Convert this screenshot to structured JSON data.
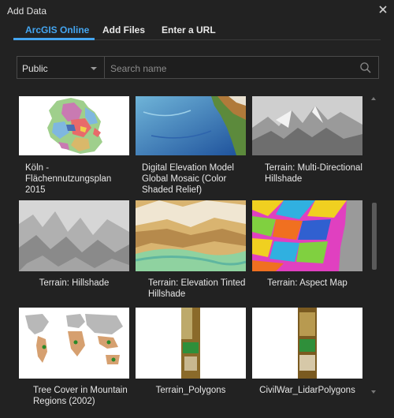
{
  "window": {
    "title": "Add Data"
  },
  "tabs": [
    {
      "label": "ArcGIS Online",
      "active": true
    },
    {
      "label": "Add Files",
      "active": false
    },
    {
      "label": "Enter a URL",
      "active": false
    }
  ],
  "filter": {
    "selected": "Public"
  },
  "search": {
    "placeholder": "Search name",
    "value": ""
  },
  "items": [
    {
      "title": "Köln - Flächennutzungsplan 2015",
      "thumbnail": "land-use-map"
    },
    {
      "title": "Digital Elevation Model Global Mosaic (Color Shaded Relief)",
      "thumbnail": "color-shaded-relief"
    },
    {
      "title": "Terrain: Multi-Directional Hillshade",
      "thumbnail": "multidirectional-hillshade"
    },
    {
      "title": "Terrain: Hillshade",
      "thumbnail": "hillshade"
    },
    {
      "title": "Terrain: Elevation Tinted Hillshade",
      "thumbnail": "elevation-tinted-hillshade"
    },
    {
      "title": "Terrain: Aspect Map",
      "thumbnail": "aspect-map"
    },
    {
      "title": "Tree Cover in Mountain Regions (2002)",
      "thumbnail": "world-tree-cover"
    },
    {
      "title": "Terrain_Polygons",
      "thumbnail": "terrain-strip"
    },
    {
      "title": "CivilWar_LidarPolygons",
      "thumbnail": "lidar-strip"
    }
  ],
  "colors": {
    "accent": "#44a5f0",
    "background": "#222222",
    "panel": "#1e1e1e",
    "border": "#4a4a4a"
  }
}
